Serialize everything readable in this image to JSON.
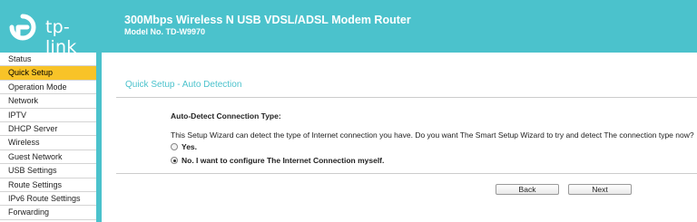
{
  "header": {
    "brand": "tp-link",
    "title": "300Mbps Wireless N USB VDSL/ADSL Modem Router",
    "model": "Model No. TD-W9970"
  },
  "sidebar": {
    "items": [
      {
        "label": "Status",
        "active": false
      },
      {
        "label": "Quick Setup",
        "active": true
      },
      {
        "label": "Operation Mode",
        "active": false
      },
      {
        "label": "Network",
        "active": false
      },
      {
        "label": "IPTV",
        "active": false
      },
      {
        "label": "DHCP Server",
        "active": false
      },
      {
        "label": "Wireless",
        "active": false
      },
      {
        "label": "Guest Network",
        "active": false
      },
      {
        "label": "USB Settings",
        "active": false
      },
      {
        "label": "Route Settings",
        "active": false
      },
      {
        "label": "IPv6 Route Settings",
        "active": false
      },
      {
        "label": "Forwarding",
        "active": false
      }
    ]
  },
  "main": {
    "section_title": "Quick Setup - Auto Detection",
    "sub_title": "Auto-Detect Connection Type:",
    "description": "This Setup Wizard can detect the type of Internet connection you have. Do you want The Smart Setup Wizard to try and detect The connection type now?",
    "options": [
      {
        "label": "Yes.",
        "checked": false
      },
      {
        "label": "No. I want to configure The Internet Connection myself.",
        "checked": true
      }
    ],
    "back_label": "Back",
    "next_label": "Next"
  },
  "colors": {
    "accent": "#4bc2cc",
    "active_menu": "#f8c328"
  }
}
